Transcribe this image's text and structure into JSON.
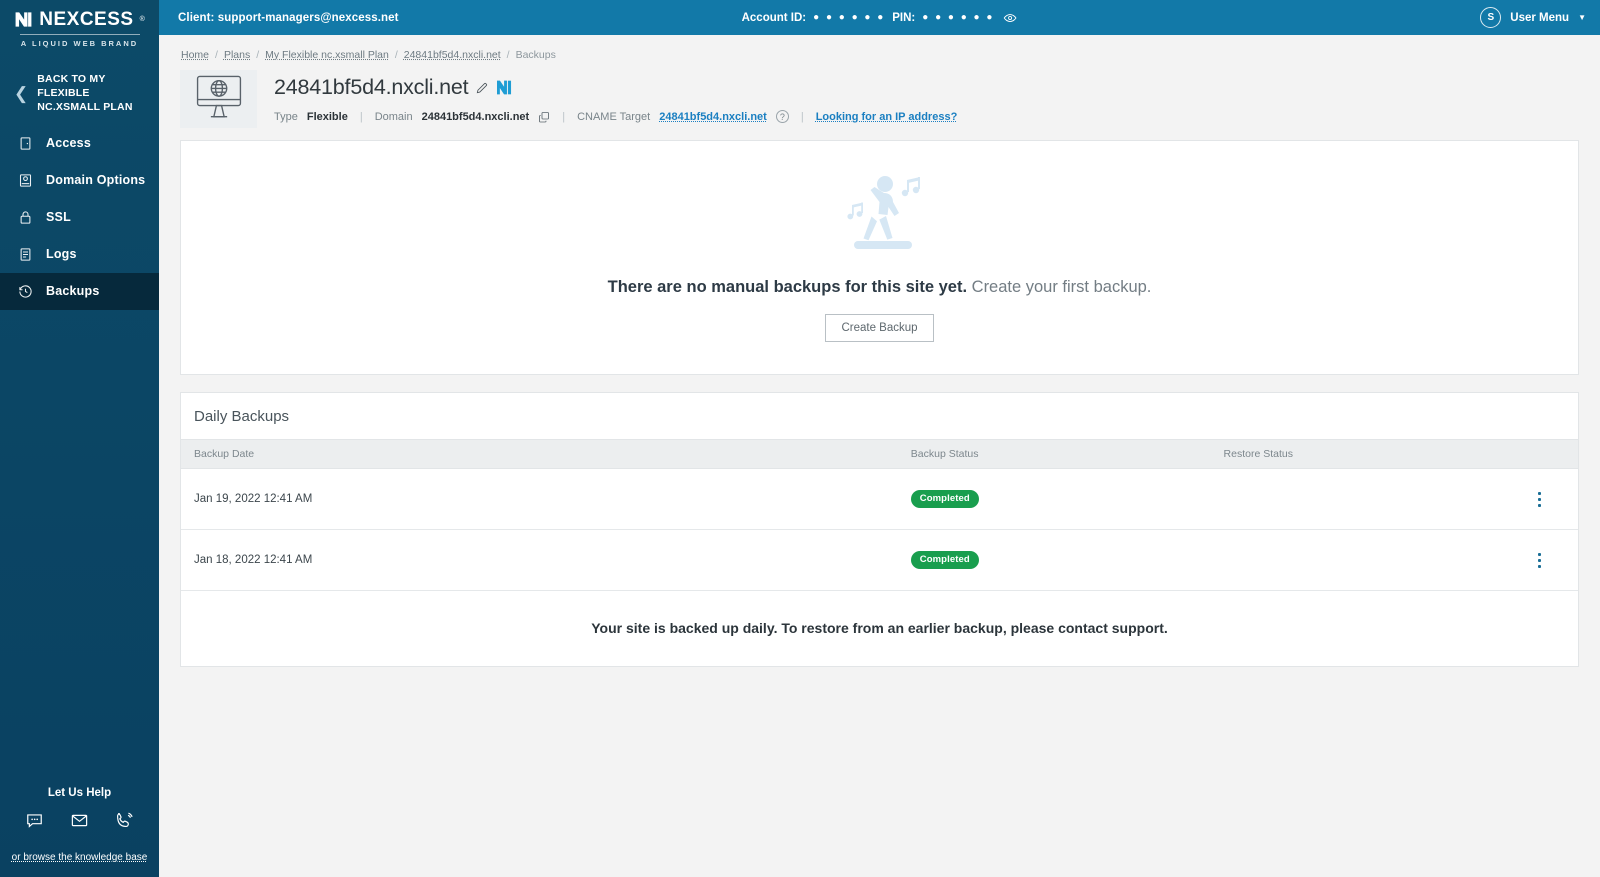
{
  "brand": {
    "name": "NEXCESS",
    "trademark": "®",
    "tagline": "A LIQUID WEB BRAND"
  },
  "sidebar": {
    "back_link": "BACK TO MY FLEXIBLE NC.XSMALL PLAN",
    "items": [
      {
        "label": "Access",
        "icon": "access-icon",
        "active": false
      },
      {
        "label": "Domain Options",
        "icon": "domain-options-icon",
        "active": false
      },
      {
        "label": "SSL",
        "icon": "lock-icon",
        "active": false
      },
      {
        "label": "Logs",
        "icon": "logs-icon",
        "active": false
      },
      {
        "label": "Backups",
        "icon": "backups-clock-icon",
        "active": true
      }
    ],
    "help": {
      "title": "Let Us Help",
      "icons": [
        "chat-icon",
        "email-icon",
        "phone-icon"
      ],
      "knowledge_base_link": "or browse the knowledge base"
    }
  },
  "topbar": {
    "client_label": "Client:",
    "client_email": "support-managers@nexcess.net",
    "account_id_label": "Account ID:",
    "account_id_masked": "● ● ● ● ● ●",
    "pin_label": "PIN:",
    "pin_masked": "● ● ● ● ● ●",
    "reveal_icon": "eye-icon",
    "user_menu_label": "User Menu",
    "avatar_initial": "S",
    "bg_color": "#1279a8"
  },
  "breadcrumb": {
    "items": [
      "Home",
      "Plans",
      "My Flexible nc.xsmall Plan",
      "24841bf5d4.nxcli.net",
      "Backups"
    ],
    "separator": "/"
  },
  "site": {
    "thumb_icon": "monitor-globe-icon",
    "title": "24841bf5d4.nxcli.net",
    "edit_icon": "pencil-icon",
    "brand_icon": "nexcess-n-icon",
    "type_label": "Type",
    "type_value": "Flexible",
    "domain_label": "Domain",
    "domain_value": "24841bf5d4.nxcli.net",
    "copy_icon": "copy-icon",
    "cname_label": "CNAME Target",
    "cname_value": "24841bf5d4.nxcli.net",
    "help_icon": "question-mark-icon",
    "ip_link": "Looking for an IP address?"
  },
  "empty_state": {
    "illustration": "dancing-person-with-music-notes-icon",
    "headline_bold": "There are no manual backups for this site yet.",
    "headline_rest": " Create your first backup.",
    "button_label": "Create Backup"
  },
  "daily_backups": {
    "title": "Daily Backups",
    "columns": [
      "Backup Date",
      "Backup Status",
      "Restore Status",
      ""
    ],
    "rows": [
      {
        "date": "Jan 19, 2022 12:41 AM",
        "backup_status": "Completed",
        "restore_status": "",
        "menu_icon": "kebab-menu-icon"
      },
      {
        "date": "Jan 18, 2022 12:41 AM",
        "backup_status": "Completed",
        "restore_status": "",
        "menu_icon": "kebab-menu-icon"
      }
    ],
    "footer_note": "Your site is backed up daily. To restore from an earlier backup, please contact support.",
    "status_color": "#199e4e"
  }
}
